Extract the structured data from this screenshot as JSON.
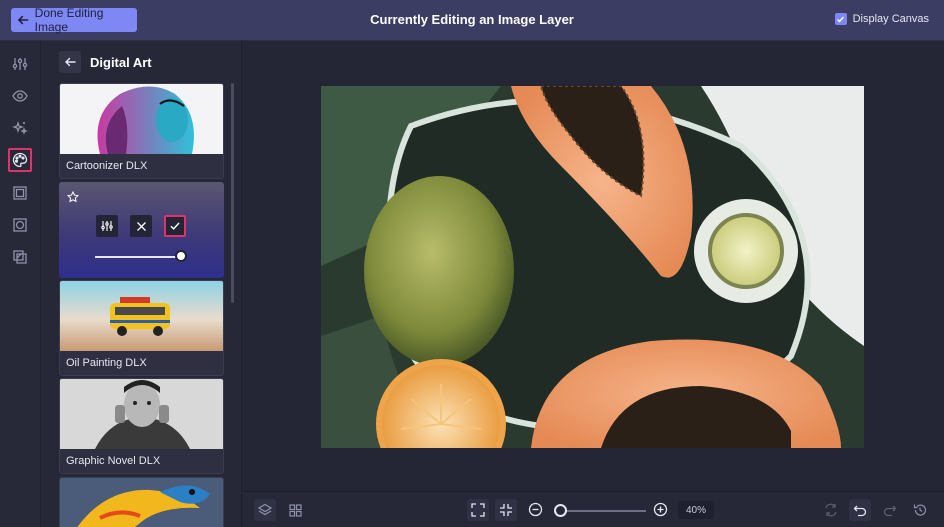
{
  "topbar": {
    "done_label": "Done Editing Image",
    "title": "Currently Editing an Image Layer",
    "display_canvas_label": "Display Canvas",
    "display_canvas_checked": true
  },
  "rail": {
    "icons": [
      "sliders-icon",
      "eye-icon",
      "sparkle-icon",
      "palette-icon",
      "frame-icon",
      "mask-icon",
      "layers-overlay-icon"
    ],
    "active": "palette-icon"
  },
  "panel": {
    "title": "Digital Art",
    "effects": [
      {
        "label": "Cartoonizer DLX"
      },
      {
        "label": "Oil Painting DLX"
      },
      {
        "label": "Graphic Novel DLX"
      }
    ]
  },
  "zoom": {
    "value": "40%",
    "level": 0.1
  },
  "colors": {
    "accent": "#7e88f4",
    "highlight": "#e0336b",
    "topbar": "#3b3d63"
  }
}
